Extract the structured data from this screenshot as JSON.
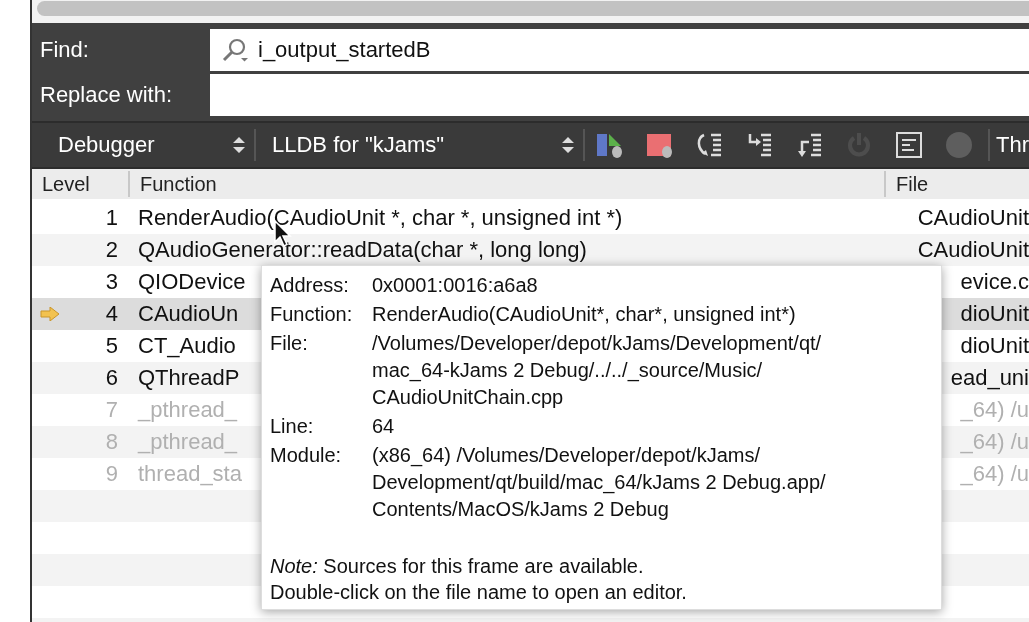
{
  "find": {
    "label": "Find:",
    "value": "i_output_startedB"
  },
  "replace": {
    "label": "Replace with:"
  },
  "toolbar": {
    "selectors": [
      {
        "label": "Debugger"
      },
      {
        "label": "LLDB for \"kJams\""
      }
    ],
    "buttons": [
      {
        "kind": "continue",
        "disabled": false
      },
      {
        "kind": "stop",
        "disabled": false
      },
      {
        "kind": "step-over",
        "disabled": false
      },
      {
        "kind": "step-into",
        "disabled": false
      },
      {
        "kind": "step-out",
        "disabled": false
      },
      {
        "kind": "restart",
        "disabled": true
      },
      {
        "kind": "frame",
        "disabled": false
      },
      {
        "kind": "record",
        "disabled": false
      }
    ],
    "trailing_label": "Thr"
  },
  "table": {
    "columns": [
      "Level",
      "Function",
      "File"
    ],
    "rows": [
      {
        "level": "1",
        "function": "RenderAudio(CAudioUnit *, char *, unsigned int *)",
        "file": "CAudioUnit",
        "selected": false,
        "current": false,
        "dimmed": false
      },
      {
        "level": "2",
        "function": "QAudioGenerator::readData(char *, long long)",
        "file": "CAudioUnit",
        "selected": false,
        "current": false,
        "dimmed": false
      },
      {
        "level": "3",
        "function": "QIODevice",
        "file": "evice.c",
        "selected": false,
        "current": false,
        "dimmed": false
      },
      {
        "level": "4",
        "function": "CAudioUn",
        "file": "dioUnit",
        "selected": true,
        "current": true,
        "dimmed": false
      },
      {
        "level": "5",
        "function": "CT_Audio",
        "file": "dioUnit",
        "selected": false,
        "current": false,
        "dimmed": false
      },
      {
        "level": "6",
        "function": "QThreadP",
        "file": "ead_uni",
        "selected": false,
        "current": false,
        "dimmed": false
      },
      {
        "level": "7",
        "function": "_pthread_",
        "file": "_64) /u",
        "selected": false,
        "current": false,
        "dimmed": true
      },
      {
        "level": "8",
        "function": "_pthread_",
        "file": "_64) /u",
        "selected": false,
        "current": false,
        "dimmed": true
      },
      {
        "level": "9",
        "function": "thread_sta",
        "file": "_64) /u",
        "selected": false,
        "current": false,
        "dimmed": true
      }
    ]
  },
  "tooltip": {
    "fields": [
      {
        "label": "Address:",
        "lines": [
          "0x0001:0016:a6a8"
        ]
      },
      {
        "label": "Function:",
        "lines": [
          "RenderAudio(CAudioUnit*, char*, unsigned int*)"
        ]
      },
      {
        "label": "File:",
        "lines": [
          "/Volumes/Developer/depot/kJams/Development/qt/",
          "mac_64-kJams 2 Debug/../../_source/Music/",
          "CAudioUnitChain.cpp"
        ]
      },
      {
        "label": "Line:",
        "lines": [
          "64"
        ]
      },
      {
        "label": "Module:",
        "lines": [
          "(x86_64) /Volumes/Developer/depot/kJams/",
          "Development/qt/build/mac_64/kJams 2 Debug.app/",
          "Contents/MacOS/kJams 2 Debug"
        ]
      }
    ],
    "note": "*Note:* Sources for this frame are available.",
    "hint": "Double-click on the file name to open an editor."
  }
}
